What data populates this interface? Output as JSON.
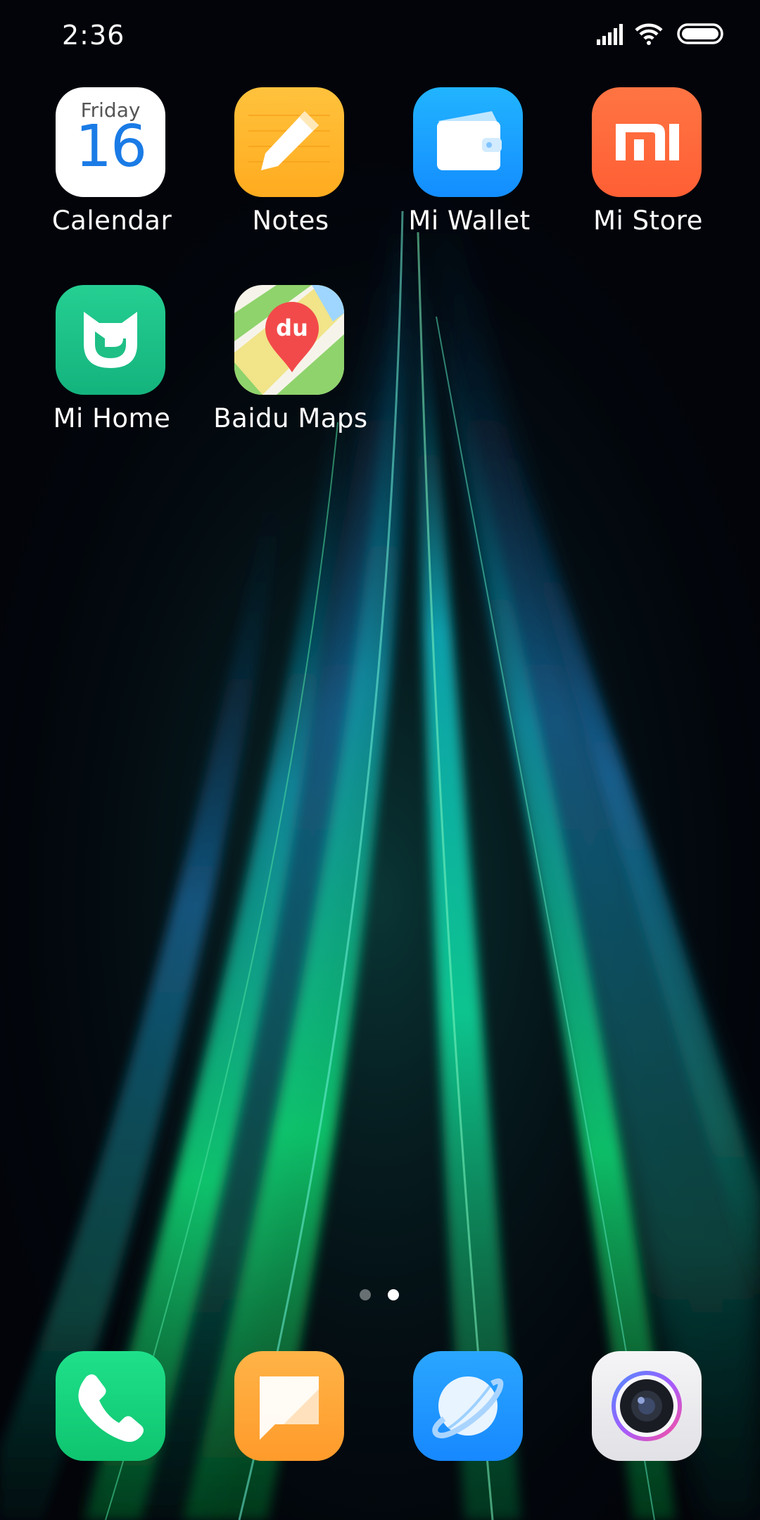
{
  "status_bar": {
    "time": "2:36",
    "icons": [
      "signal-icon",
      "wifi-icon",
      "battery-icon"
    ]
  },
  "home": {
    "apps": [
      {
        "label": "Calendar",
        "icon": "calendar-icon",
        "day": "Friday",
        "date": "16"
      },
      {
        "label": "Notes",
        "icon": "notes-icon"
      },
      {
        "label": "Mi Wallet",
        "icon": "wallet-icon"
      },
      {
        "label": "Mi Store",
        "icon": "mi-store-icon"
      },
      {
        "label": "Mi Home",
        "icon": "mi-home-icon"
      },
      {
        "label": "Baidu Maps",
        "icon": "baidu-maps-icon",
        "badge_text": "du"
      }
    ]
  },
  "page_indicator": {
    "pages": 2,
    "current": 2
  },
  "dock": {
    "apps": [
      {
        "icon": "phone-icon"
      },
      {
        "icon": "messages-icon"
      },
      {
        "icon": "browser-icon"
      },
      {
        "icon": "camera-icon"
      }
    ]
  },
  "colors": {
    "wallpaper_base": "#02040a",
    "calendar_date": "#1a7be6",
    "notes": "#ffb52e",
    "wallet": "#1aa2ff",
    "mi_store": "#ff6a3d",
    "mi_home": "#1fc38a",
    "phone": "#16d67e",
    "messages": "#ffa73a",
    "browser": "#2396ff",
    "camera": "#ececf0"
  }
}
